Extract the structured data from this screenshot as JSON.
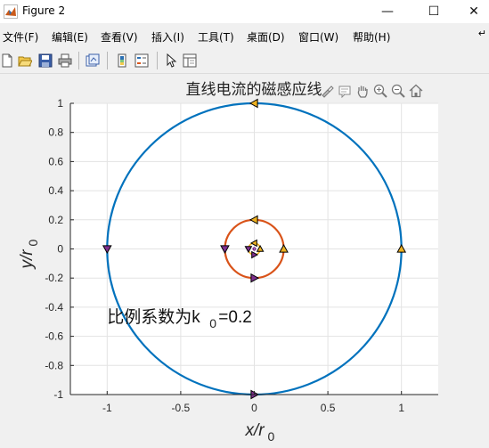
{
  "window": {
    "title": "Figure 2",
    "minimize_glyph": "—",
    "maximize_glyph": "☐",
    "close_glyph": "✕"
  },
  "menu": {
    "items": [
      "文件(F)",
      "编辑(E)",
      "查看(V)",
      "插入(I)",
      "工具(T)",
      "桌面(D)",
      "窗口(W)",
      "帮助(H)"
    ],
    "overflow_glyph": "↵"
  },
  "toolbar": {
    "icons": [
      "new-figure-icon",
      "open-file-icon",
      "save-icon",
      "print-icon",
      "link-plot-icon",
      "insert-colorbar-icon",
      "insert-legend-icon",
      "edit-plot-icon",
      "property-inspector-icon"
    ]
  },
  "axes_toolbar": {
    "icons": [
      "brush-icon",
      "data-tips-icon",
      "pan-icon",
      "zoom-in-icon",
      "zoom-out-icon",
      "home-icon"
    ]
  },
  "colors": {
    "series1": "#0072bd",
    "series2": "#d95319",
    "grid": "#e3e3e3",
    "axis": "#262626",
    "plot_bg": "#ffffff"
  },
  "chart_data": {
    "type": "line",
    "title": "直线电流的磁感应线",
    "xlabel": "x/r",
    "xlabel_sub": "0",
    "ylabel": "y/r",
    "ylabel_sub": "0",
    "xlim": [
      -1.25,
      1.25
    ],
    "ylim": [
      -1,
      1
    ],
    "xticks": [
      -1,
      -0.5,
      0,
      0.5,
      1
    ],
    "xtick_labels": [
      "-1",
      "-0.5",
      "0",
      "0.5",
      "1"
    ],
    "yticks": [
      -1,
      -0.8,
      -0.6,
      -0.4,
      -0.2,
      0,
      0.2,
      0.4,
      0.6,
      0.8,
      1
    ],
    "ytick_labels": [
      "-1",
      "-0.8",
      "-0.6",
      "-0.4",
      "-0.2",
      "0",
      "0.2",
      "0.4",
      "0.6",
      "0.8",
      "1"
    ],
    "grid": true,
    "circles": [
      {
        "radius": 1,
        "color": "#0072bd"
      },
      {
        "radius": 0.2,
        "color": "#d95319"
      },
      {
        "radius": 0.04,
        "color": "#edb120"
      },
      {
        "radius": 0.008,
        "color": "#7e2f8e"
      }
    ],
    "direction_markers": [
      {
        "radius": 1,
        "points": [
          [
            0,
            1,
            "left"
          ],
          [
            -1,
            0,
            "down"
          ],
          [
            0,
            -1,
            "right"
          ],
          [
            1,
            0,
            "up"
          ]
        ]
      },
      {
        "radius": 0.2,
        "points": [
          [
            0,
            0.2,
            "left"
          ],
          [
            -0.2,
            0,
            "down"
          ],
          [
            0,
            -0.2,
            "right"
          ],
          [
            0.2,
            0,
            "up"
          ]
        ]
      },
      {
        "radius": 0.04,
        "points": [
          [
            0,
            0.04,
            "left"
          ],
          [
            -0.04,
            0,
            "down"
          ],
          [
            0,
            -0.04,
            "right"
          ],
          [
            0.04,
            0,
            "up"
          ]
        ]
      }
    ],
    "annotation": {
      "text": "比例系数为k",
      "sub": "0",
      "suffix": "=0.2",
      "x": -1.0,
      "y": -0.48
    }
  }
}
